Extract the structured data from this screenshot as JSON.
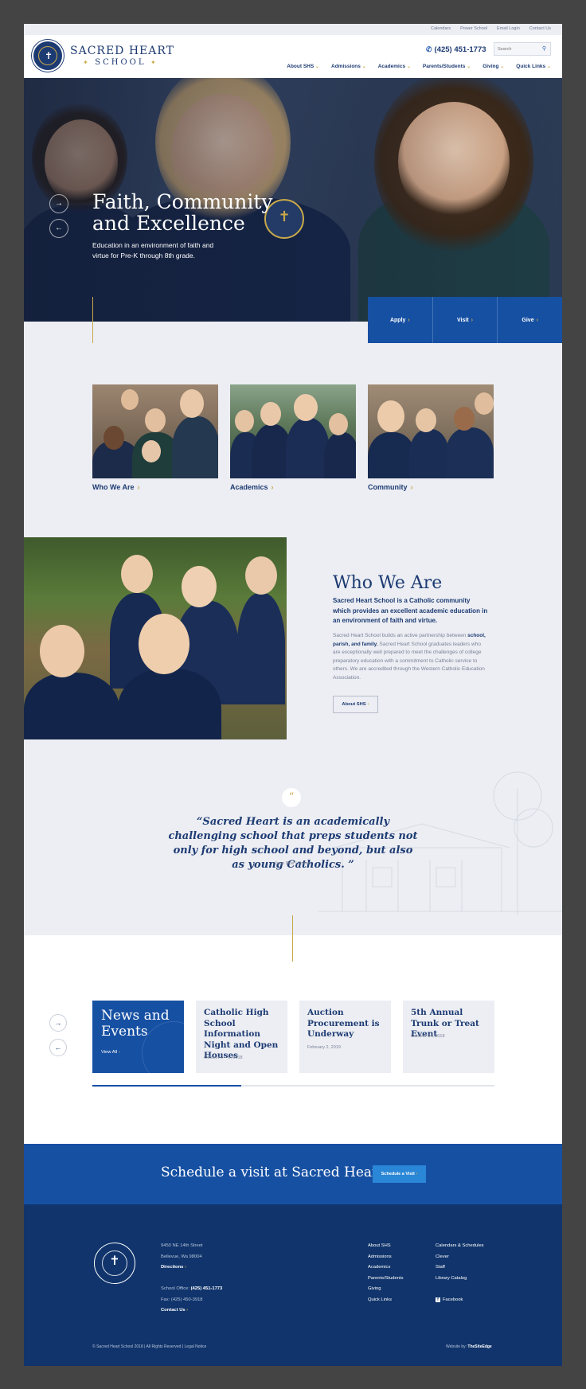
{
  "utility": {
    "links": [
      "Calendars",
      "Power School",
      "Email Login",
      "Contact Us"
    ]
  },
  "header": {
    "brand_line1": "SACRED HEART",
    "brand_line2": "SCHOOL",
    "phone": "(425) 451-1773",
    "search_placeholder": "Search",
    "nav": [
      {
        "label": "About SHS"
      },
      {
        "label": "Admissions"
      },
      {
        "label": "Academics"
      },
      {
        "label": "Parents/Students"
      },
      {
        "label": "Giving"
      },
      {
        "label": "Quick Links"
      }
    ]
  },
  "hero": {
    "title": "Faith, Community and Excellence",
    "subtitle": "Education in an environment of faith and virtue for Pre-K through 8th grade."
  },
  "cta": {
    "apply": "Apply",
    "visit": "Visit",
    "give": "Give"
  },
  "cards": [
    {
      "label": "Who We Are"
    },
    {
      "label": "Academics"
    },
    {
      "label": "Community"
    }
  ],
  "who": {
    "title": "Who We Are",
    "lead": "Sacred Heart School is a Catholic community which provides an excellent academic education in an environment of faith and virtue.",
    "body_before": "Sacred Heart School builds an active partnership between ",
    "body_bold": "school, parish, and family.",
    "body_after": " Sacred Heart School graduates leaders who are exceptionally well prepared to meet the challenges of college preparatory education with a commitment to Catholic service to others. We are accredited through the Western Catholic Education Association.",
    "button": "About SHS"
  },
  "quote": {
    "mark": "“",
    "text": "“Sacred Heart is an academically challenging school that preps students not only for high school and beyond, but also as young Catholics. ”",
    "attribution": "Jane Doe | Parent"
  },
  "news": {
    "feature_title": "News and Events",
    "view_all": "View All",
    "progress_fraction": 0.37,
    "items": [
      {
        "title": "Catholic High School Information Night and Open Houses",
        "date": "October 2 – 6, 2018"
      },
      {
        "title": "Auction Procurement is Underway",
        "date": "February 2, 2019"
      },
      {
        "title": "5th Annual Trunk or Treat Event",
        "date": "October 24, 2018"
      }
    ]
  },
  "schedule": {
    "text": "Schedule a visit at Sacred Heart",
    "button": "Schedule a Visit"
  },
  "footer": {
    "address1": "9450 NE 14th Street",
    "address2": "Bellevue, Wa 98004",
    "directions": "Directions",
    "office_label": "School Office:",
    "office_phone": "(425) 451-1773",
    "fax": "Fax: (425) 450-3918",
    "contact": "Contact Us",
    "links_col1": [
      "About SHS",
      "Admissions",
      "Academics",
      "Parents/Students",
      "Giving",
      "Quick Links"
    ],
    "links_col2": [
      "Calendars & Schedules",
      "Clever",
      "Staff",
      "Library Catalog"
    ],
    "facebook": "Facebook",
    "copyright": "© Sacred Heart School 2018  |  All Rights Reserved  |  Legal Notice",
    "credit_label": "Website by:",
    "credit_name": "TheSiteEdge"
  },
  "colors": {
    "navy": "#1d3b73",
    "royal_blue": "#1650a3",
    "gold": "#c9a94a",
    "footer_navy": "#10346b",
    "light_bg": "#eceef3"
  }
}
